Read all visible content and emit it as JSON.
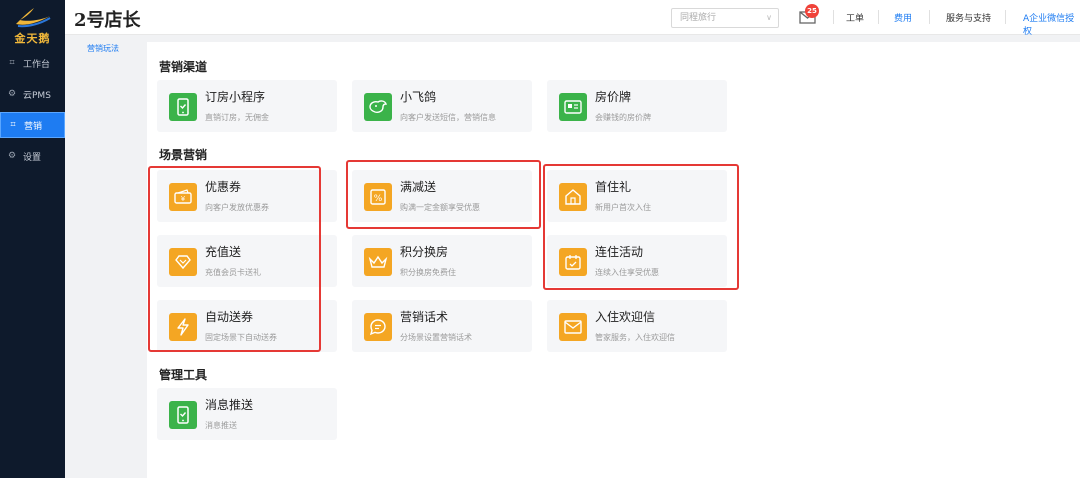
{
  "brand": {
    "logo_text": "金天鹅"
  },
  "sidebar": {
    "items": [
      {
        "label": "工作台",
        "icon": "desktop-icon"
      },
      {
        "label": "云PMS",
        "icon": "gear-icon"
      },
      {
        "label": "营销",
        "icon": "desktop-icon",
        "active": true
      },
      {
        "label": "设置",
        "icon": "gear-icon"
      }
    ]
  },
  "header": {
    "store_name": "2号店长",
    "hotel_select": {
      "value": "同程旅行"
    },
    "mail_badge": "25",
    "links": [
      "工单",
      "费用",
      "服务与支持",
      "A企业微信授权"
    ]
  },
  "subnav": {
    "active_label": "营销玩法"
  },
  "sections": {
    "channels": {
      "title": "营销渠道"
    },
    "scenes": {
      "title": "场景营销"
    },
    "tools": {
      "title": "管理工具"
    }
  },
  "cards": {
    "miniapp": {
      "title": "订房小程序",
      "desc": "直销订房，无佣金"
    },
    "pigeon": {
      "title": "小飞鸽",
      "desc": "向客户发送短信，营销信息"
    },
    "pricetag": {
      "title": "房价牌",
      "desc": "会赚钱的房价牌"
    },
    "coupon": {
      "title": "优惠券",
      "desc": "向客户发放优惠券"
    },
    "discount": {
      "title": "满减送",
      "desc": "购满一定金额享受优惠"
    },
    "firststay": {
      "title": "首住礼",
      "desc": "新用户首次入住"
    },
    "recharge": {
      "title": "充值送",
      "desc": "充值会员卡送礼"
    },
    "points": {
      "title": "积分换房",
      "desc": "积分换房免费住"
    },
    "consecutive": {
      "title": "连住活动",
      "desc": "连续入住享受优惠"
    },
    "autocoupon": {
      "title": "自动送券",
      "desc": "固定场景下自动送券"
    },
    "script": {
      "title": "营销话术",
      "desc": "分场景设置营销话术"
    },
    "welcome": {
      "title": "入住欢迎信",
      "desc": "管家服务，入住欢迎信"
    },
    "push": {
      "title": "消息推送",
      "desc": "消息推送"
    }
  },
  "colors": {
    "sidebar_bg": "#0e1a2c",
    "accent": "#1e7cf2",
    "green": "#3bb34a",
    "orange": "#f4a623",
    "highlight": "#e53935"
  }
}
